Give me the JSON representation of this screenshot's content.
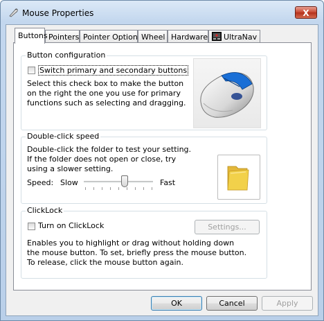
{
  "window": {
    "title": "Mouse Properties",
    "close_glyph": "X"
  },
  "tabs": [
    {
      "label": "Buttons",
      "active": true
    },
    {
      "label": "Pointers"
    },
    {
      "label": "Pointer Options"
    },
    {
      "label": "Wheel"
    },
    {
      "label": "Hardware"
    },
    {
      "label": "UltraNav"
    }
  ],
  "button_config": {
    "group_label": "Button configuration",
    "switch_checkbox_label": "Switch primary and secondary buttons",
    "switch_checked": false,
    "description": "Select this check box to make the button on the right the one you use for primary functions such as selecting and dragging."
  },
  "double_click": {
    "group_label": "Double-click speed",
    "description": "Double-click the folder to test your setting. If the folder does not open or close, try using a slower setting.",
    "speed_label": "Speed:",
    "slow_label": "Slow",
    "fast_label": "Fast",
    "speed_value": 0.6
  },
  "clicklock": {
    "group_label": "ClickLock",
    "checkbox_label": "Turn on ClickLock",
    "checked": false,
    "settings_button": "Settings...",
    "description": "Enables you to highlight or drag without holding down the mouse button. To set, briefly press the mouse button. To release, click the mouse button again."
  },
  "footer": {
    "ok": "OK",
    "cancel": "Cancel",
    "apply": "Apply"
  },
  "colors": {
    "accent_blue": "#1a6fd6",
    "folder_yellow": "#f2d14a",
    "close_red": "#c7452f"
  }
}
